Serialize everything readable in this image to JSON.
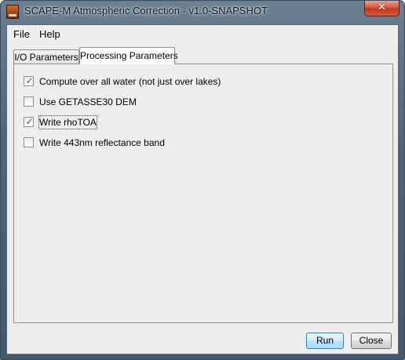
{
  "window": {
    "title": "SCAPE-M Atmospheric Correction - v1.0-SNAPSHOT",
    "icon": "scape-m-app-icon",
    "close_glyph": "✕"
  },
  "menu": {
    "items": [
      {
        "label": "File"
      },
      {
        "label": "Help"
      }
    ]
  },
  "tabs": [
    {
      "label": "I/O Parameters",
      "selected": false
    },
    {
      "label": "Processing Parameters",
      "selected": true
    }
  ],
  "options": [
    {
      "label": "Compute over all water (not just over lakes)",
      "checked": true,
      "mark": "✓"
    },
    {
      "label": "Use GETASSE30 DEM",
      "checked": false,
      "mark": ""
    },
    {
      "label": "Write rhoTOA",
      "checked": true,
      "mark": "✓",
      "focused": true
    },
    {
      "label": "Write 443nm reflectance band",
      "checked": false,
      "mark": ""
    }
  ],
  "buttons": {
    "run_label": "Run",
    "close_label": "Close"
  },
  "colors": {
    "accent": "#3c7fb1",
    "checkmark": "#4a5a78",
    "titlebar": "#4f6478",
    "close_button": "#c2371d"
  }
}
